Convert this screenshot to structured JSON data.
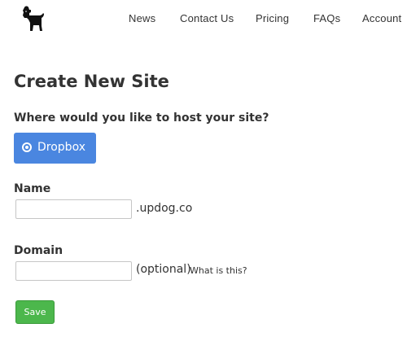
{
  "nav": {
    "items": [
      {
        "label": "News"
      },
      {
        "label": "Contact Us"
      },
      {
        "label": "Pricing"
      },
      {
        "label": "FAQs"
      },
      {
        "label": "Account"
      }
    ]
  },
  "logo": {
    "icon": "dog-icon"
  },
  "page": {
    "title": "Create New Site"
  },
  "hosting": {
    "question": "Where would you like to host your site?",
    "option_label": "Dropbox",
    "option_selected": true,
    "accent_color": "#4a86e0"
  },
  "name_field": {
    "label": "Name",
    "value": "",
    "suffix": ".updog.co"
  },
  "domain_field": {
    "label": "Domain",
    "value": "",
    "optional_text": "(optional)",
    "help_link": "What is this?"
  },
  "save": {
    "label": "Save",
    "color": "#4cb74c"
  }
}
